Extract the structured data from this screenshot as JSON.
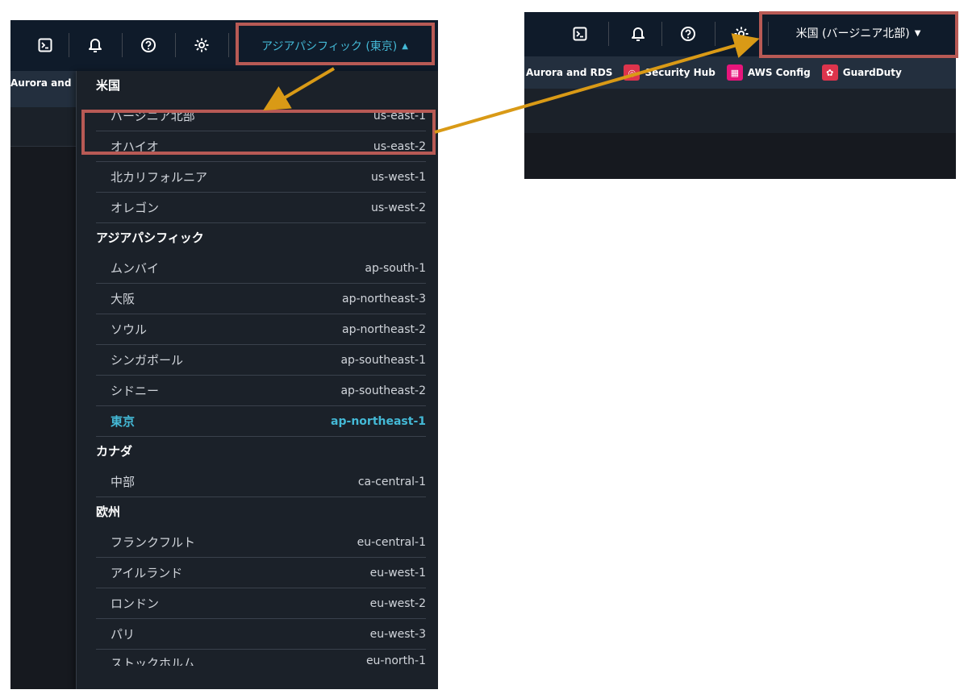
{
  "left": {
    "topbar": {
      "icons": [
        "cloudshell-icon",
        "bell-icon",
        "help-icon",
        "gear-icon"
      ],
      "region_label": "アジアパシフィック (東京)"
    },
    "subbar_text": "Aurora and",
    "menu": {
      "groups": [
        {
          "name": "米国",
          "items": [
            {
              "label": "バージニア北部",
              "code": "us-east-1"
            },
            {
              "label": "オハイオ",
              "code": "us-east-2"
            },
            {
              "label": "北カリフォルニア",
              "code": "us-west-1"
            },
            {
              "label": "オレゴン",
              "code": "us-west-2"
            }
          ]
        },
        {
          "name": "アジアパシフィック",
          "items": [
            {
              "label": "ムンバイ",
              "code": "ap-south-1"
            },
            {
              "label": "大阪",
              "code": "ap-northeast-3"
            },
            {
              "label": "ソウル",
              "code": "ap-northeast-2"
            },
            {
              "label": "シンガポール",
              "code": "ap-southeast-1"
            },
            {
              "label": "シドニー",
              "code": "ap-southeast-2"
            },
            {
              "label": "東京",
              "code": "ap-northeast-1",
              "selected": true
            }
          ]
        },
        {
          "name": "カナダ",
          "items": [
            {
              "label": "中部",
              "code": "ca-central-1"
            }
          ]
        },
        {
          "name": "欧州",
          "items": [
            {
              "label": "フランクフルト",
              "code": "eu-central-1"
            },
            {
              "label": "アイルランド",
              "code": "eu-west-1"
            },
            {
              "label": "ロンドン",
              "code": "eu-west-2"
            },
            {
              "label": "パリ",
              "code": "eu-west-3"
            },
            {
              "label": "ストックホルム",
              "code": "eu-north-1",
              "partial": true
            }
          ]
        }
      ]
    }
  },
  "right": {
    "topbar": {
      "icons": [
        "cloudshell-icon",
        "bell-icon",
        "help-icon",
        "gear-icon"
      ],
      "region_label": "米国 (バージニア北部)"
    },
    "favorites": [
      {
        "label": "Aurora and RDS",
        "icon": "",
        "color": ""
      },
      {
        "label": "Security Hub",
        "icon": "security-hub-icon",
        "color": "#dd344c"
      },
      {
        "label": "AWS Config",
        "icon": "aws-config-icon",
        "color": "#e7157b"
      },
      {
        "label": "GuardDuty",
        "icon": "guardduty-icon",
        "color": "#dd344c"
      }
    ]
  },
  "colors": {
    "highlight": "#b85a55",
    "arrow": "#d99a16",
    "selected": "#44b9d6"
  }
}
